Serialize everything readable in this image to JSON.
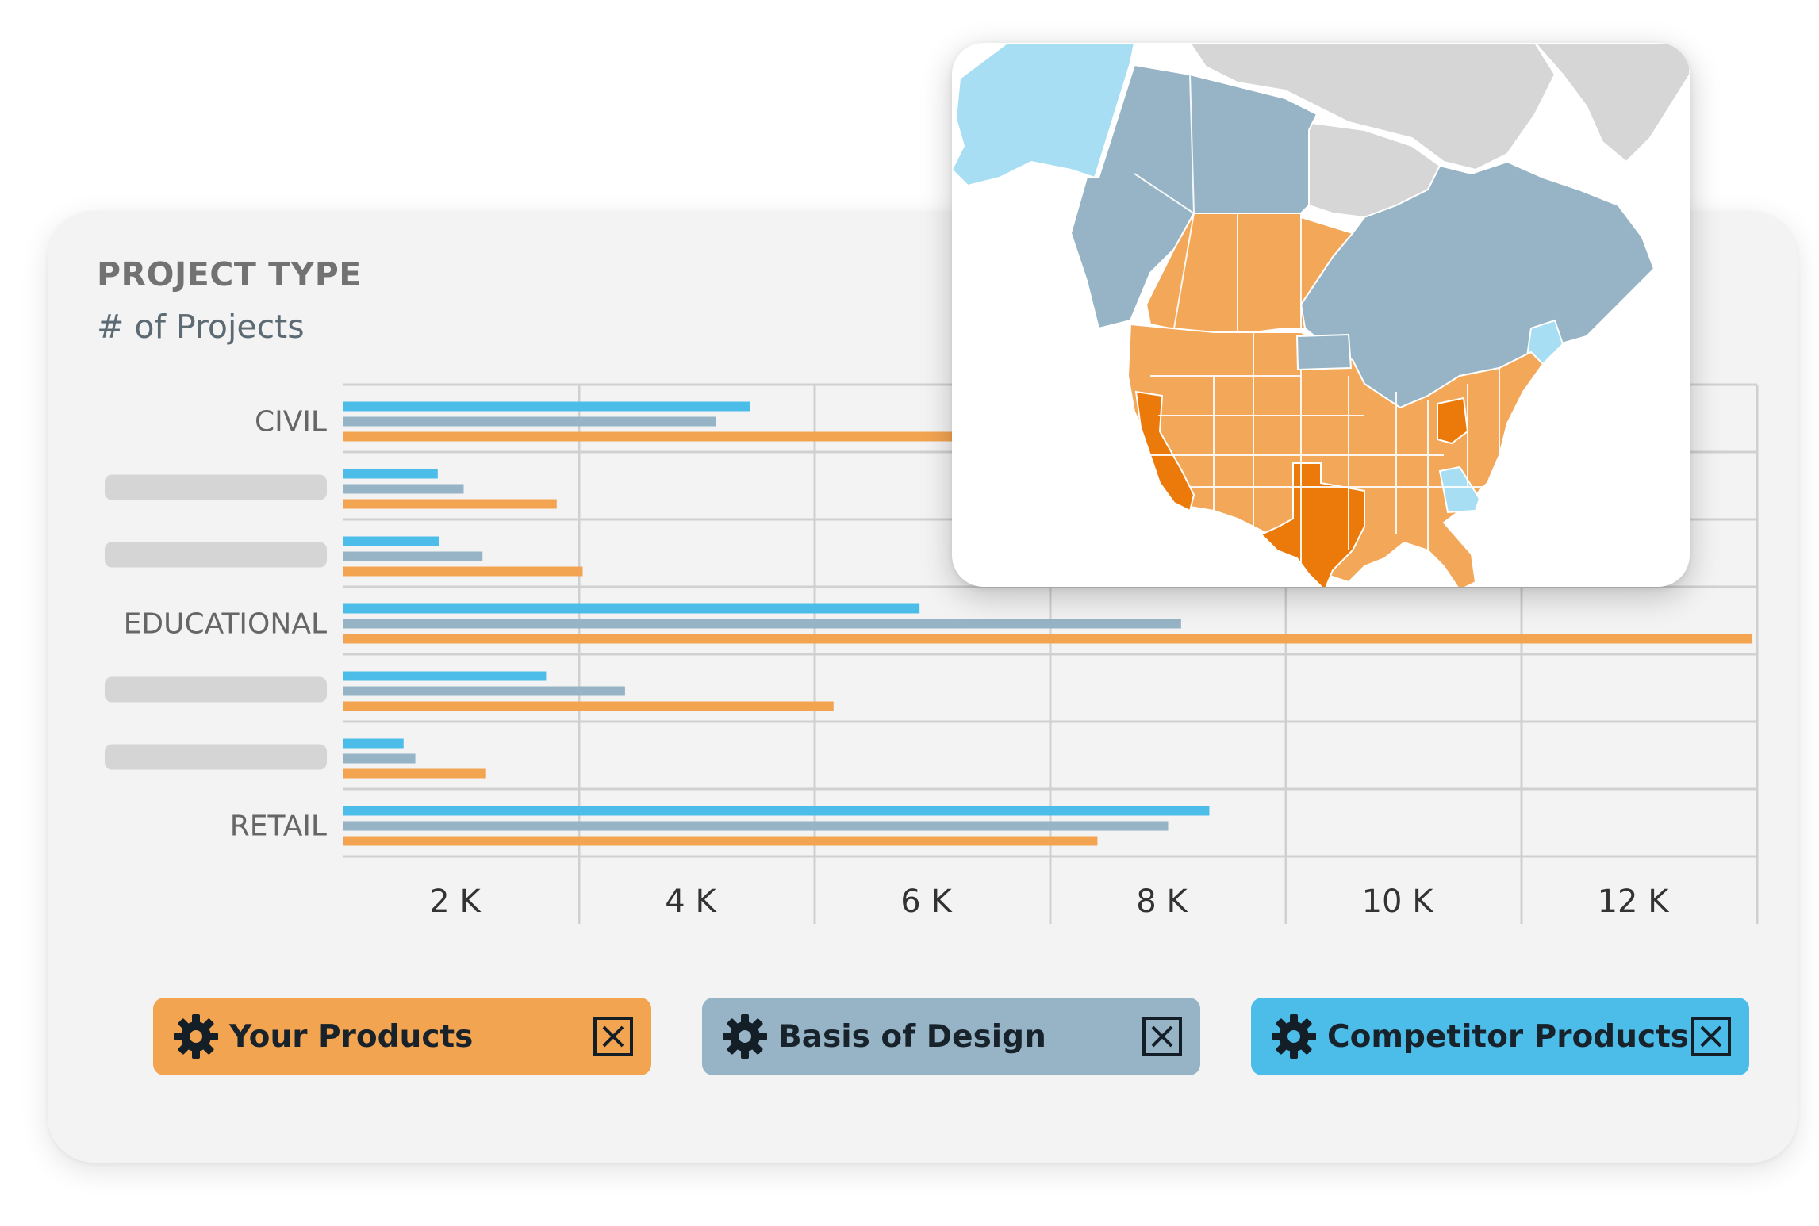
{
  "chart_data": {
    "type": "bar",
    "orientation": "horizontal",
    "title": "PROJECT TYPE",
    "subtitle": "# of Projects",
    "categories": [
      "CIVIL",
      "",
      "",
      "EDUCATIONAL",
      "",
      "",
      "RETAIL"
    ],
    "x_ticks": [
      "2 K",
      "4 K",
      "6 K",
      "8 K",
      "10 K",
      "12 K"
    ],
    "xlim": [
      0,
      12000
    ],
    "grid": true,
    "series": [
      {
        "name": "Competitor Products",
        "color": "#4cbde9",
        "values": [
          3450,
          800,
          810,
          4890,
          1720,
          510,
          7350
        ]
      },
      {
        "name": "Basis of Design",
        "color": "#96b4c5",
        "values": [
          3160,
          1020,
          1180,
          7110,
          2390,
          610,
          7000
        ]
      },
      {
        "name": "Your Products",
        "color": "#f3a451",
        "values": [
          7800,
          1810,
          2030,
          11960,
          4160,
          1210,
          6400
        ]
      }
    ]
  },
  "legend": {
    "items": [
      {
        "label": "Your Products",
        "color": "#f3a451"
      },
      {
        "label": "Basis of Design",
        "color": "#96b4c5"
      },
      {
        "label": "Competitor Products",
        "color": "#4cbde9"
      }
    ],
    "icon": "gear-icon",
    "close_icon": "close-box-icon"
  },
  "map": {
    "colors": {
      "high": "#ec7a0a",
      "medium": "#f3a758",
      "basis": "#96b4c5",
      "competitor": "#a8def3",
      "none": "#d6d6d6"
    }
  }
}
